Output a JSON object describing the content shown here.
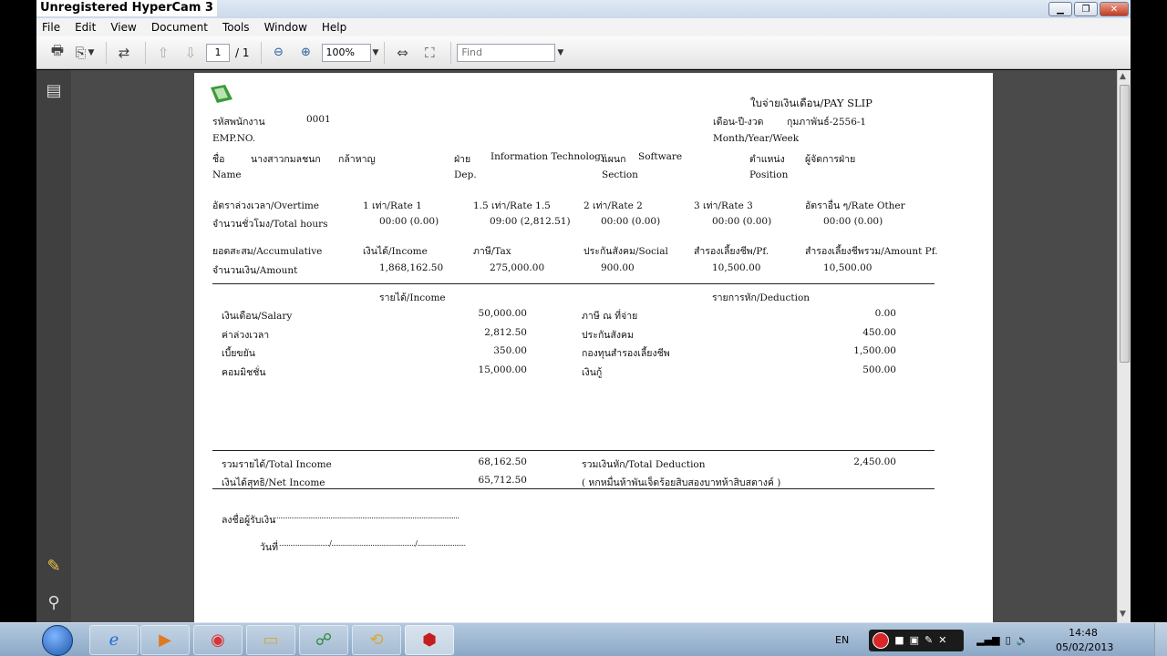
{
  "window": {
    "watermark": "Unregistered HyperCam 3"
  },
  "menu": [
    "File",
    "Edit",
    "View",
    "Document",
    "Tools",
    "Window",
    "Help"
  ],
  "toolbar": {
    "page_current": "1",
    "page_total": "/ 1",
    "zoom": "100%",
    "find_placeholder": "Find"
  },
  "payslip": {
    "title": "ใบจ่ายเงินเดือน/PAY SLIP",
    "emp_label": "รหัสพนักงาน",
    "emp_label_en": "EMP.NO.",
    "emp_no": "0001",
    "period_label": "เดือน-ปี-งวด",
    "period_label_en": "Month/Year/Week",
    "period_value": "กุมภาพันธ์-2556-1",
    "name_label": "ชื่อ",
    "name_label_en": "Name",
    "name_value": "นางสาวกมลชนก",
    "surname_value": "กล้าหาญ",
    "dept_label": "ฝ่าย",
    "dept_label_en": "Dep.",
    "dept_value": "Information Technology",
    "section_label": "แผนก",
    "section_label_en": "Section",
    "section_value": "Software",
    "position_label": "ตำแหน่ง",
    "position_label_en": "Position",
    "position_value": "ผู้จัดการฝ่าย",
    "ot_headers": [
      "อัตราล่วงเวลา/Overtime",
      "1 เท่า/Rate 1",
      "1.5 เท่า/Rate 1.5",
      "2 เท่า/Rate 2",
      "3 เท่า/Rate 3",
      "อัตราอื่น ๆ/Rate Other"
    ],
    "ot_values": [
      "จำนวนชั่วโมง/Total hours",
      "00:00 (0.00)",
      "09:00 (2,812.51)",
      "00:00 (0.00)",
      "00:00 (0.00)",
      "00:00 (0.00)"
    ],
    "acc_headers": [
      "ยอดสะสม/Accumulative",
      "เงินได้/Income",
      "ภาษี/Tax",
      "ประกันสังคม/Social",
      "สำรองเลี้ยงชีพ/Pf.",
      "สำรองเลี้ยงชีพรวม/Amount Pf."
    ],
    "acc_values": [
      "จำนวนเงิน/Amount",
      "1,868,162.50",
      "275,000.00",
      "900.00",
      "10,500.00",
      "10,500.00"
    ],
    "income_header": "รายได้/Income",
    "deduction_header": "รายการหัก/Deduction",
    "income_items": [
      {
        "label": "เงินเดือน/Salary",
        "amount": "50,000.00"
      },
      {
        "label": "ค่าล่วงเวลา",
        "amount": "2,812.50"
      },
      {
        "label": "เบี้ยขยัน",
        "amount": "350.00"
      },
      {
        "label": "คอมมิชชั่น",
        "amount": "15,000.00"
      }
    ],
    "deduction_items": [
      {
        "label": "ภาษี ณ ที่จ่าย",
        "amount": "0.00"
      },
      {
        "label": "ประกันสังคม",
        "amount": "450.00"
      },
      {
        "label": "กองทุนสำรองเลี้ยงชีพ",
        "amount": "1,500.00"
      },
      {
        "label": "เงินกู้",
        "amount": "500.00"
      }
    ],
    "total_income_label": "รวมรายได้/Total Income",
    "total_income": "68,162.50",
    "net_income_label": "เงินได้สุทธิ/Net Income",
    "net_income": "65,712.50",
    "total_deduction_label": "รวมเงินหัก/Total Deduction",
    "total_deduction": "2,450.00",
    "net_words": "( หกหมื่นห้าพันเจ็ดร้อยสิบสองบาทห้าสิบสตางค์ )",
    "sign_label": "ลงชื่อผู้รับเงิน",
    "sign_line": "....................................................................................................",
    "date_label": "วันที่",
    "date_line": ".........................../............................................./.........................."
  },
  "taskbar": {
    "lang": "EN",
    "time": "14:48",
    "date": "05/02/2013"
  }
}
